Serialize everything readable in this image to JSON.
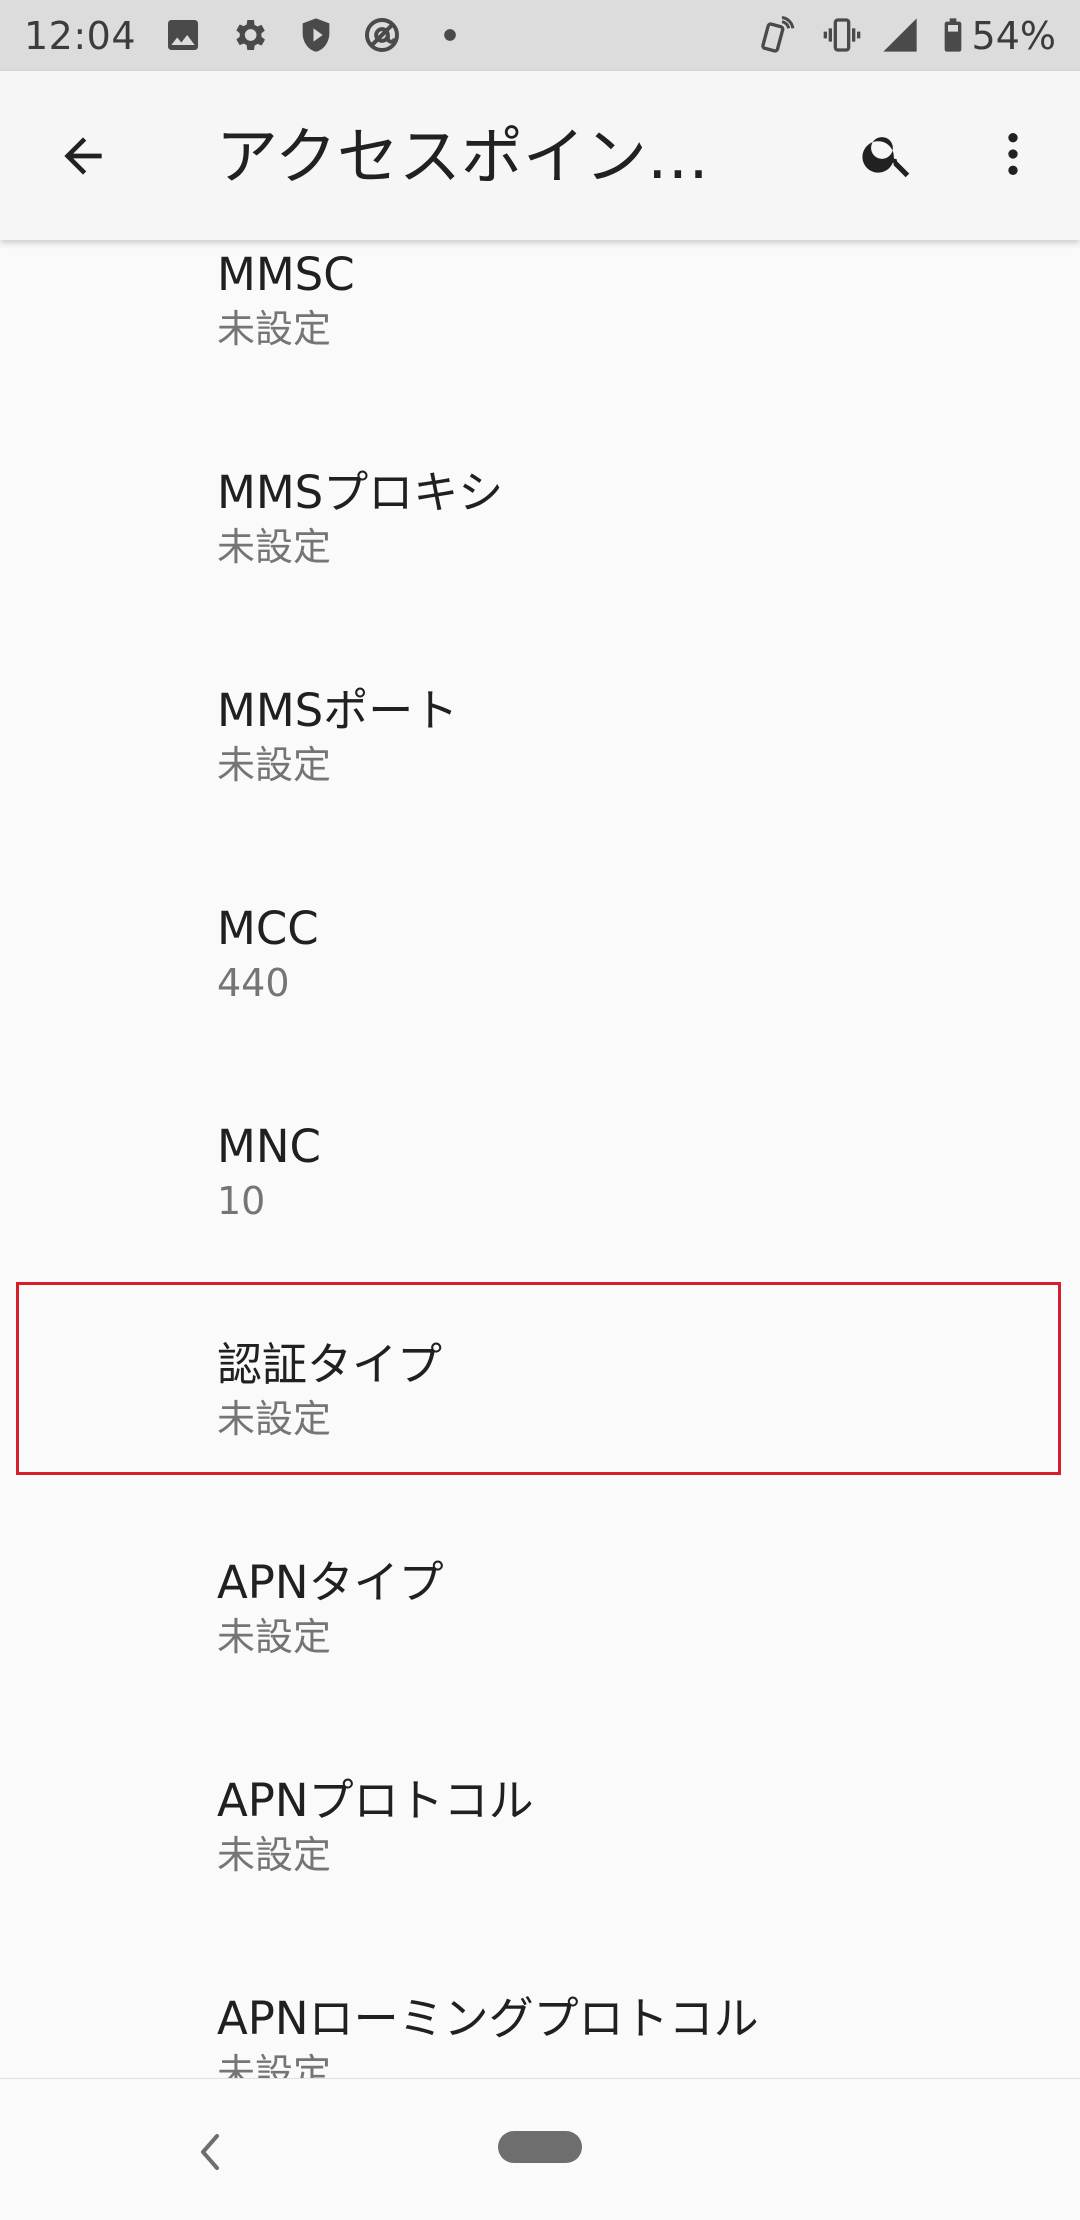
{
  "status_bar": {
    "time": "12:04",
    "battery": "54%",
    "icons_left": [
      "image-icon",
      "gear-icon",
      "shield-icon",
      "at-sign-icon",
      "dot-icon"
    ],
    "icons_right": [
      "nfc-icon",
      "vibrate-icon",
      "signal-icon",
      "battery-icon"
    ]
  },
  "app_bar": {
    "title": "アクセスポイント…",
    "back_icon": "arrow-back-icon",
    "search_icon": "search-icon",
    "more_icon": "more-vert-icon"
  },
  "settings": [
    {
      "title": "MMSC",
      "summary": "未設定"
    },
    {
      "title": "MMSプロキシ",
      "summary": "未設定"
    },
    {
      "title": "MMSポート",
      "summary": "未設定"
    },
    {
      "title": "MCC",
      "summary": "440"
    },
    {
      "title": "MNC",
      "summary": "10"
    },
    {
      "title": "認証タイプ",
      "summary": "未設定"
    },
    {
      "title": "APNタイプ",
      "summary": "未設定"
    },
    {
      "title": "APNプロトコル",
      "summary": "未設定"
    },
    {
      "title": "APNローミングプロトコル",
      "summary": "未設定"
    }
  ],
  "highlight_color": "#d61f2b",
  "nav_bar": {
    "back_icon": "nav-back-icon",
    "home_icon": "home-pill-icon"
  }
}
